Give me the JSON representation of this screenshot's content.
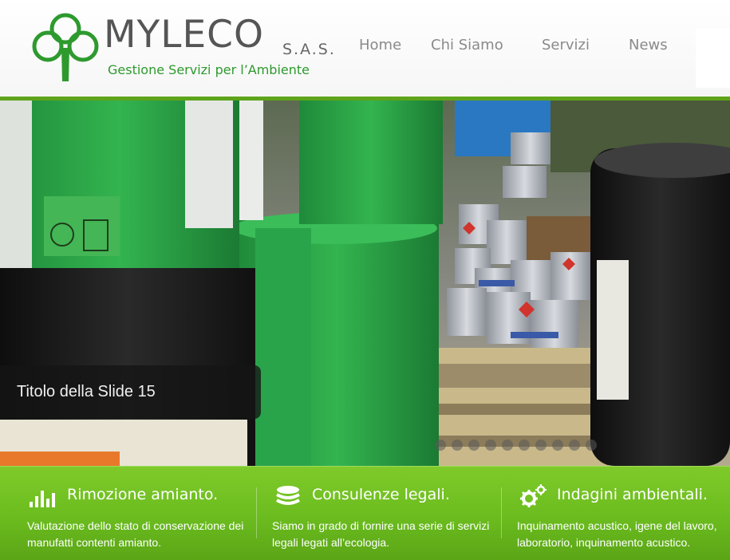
{
  "brand": {
    "name": "MYLECO",
    "suffix": "S.A.S.",
    "tagline": "Gestione Servizi per l’Ambiente",
    "logo_icon": "clover-tree-icon",
    "color": "#2e9a2e"
  },
  "nav": {
    "items": [
      {
        "label": "Home"
      },
      {
        "label": "Chi Siamo"
      },
      {
        "label": "Servizi"
      },
      {
        "label": "News"
      }
    ]
  },
  "slider": {
    "caption": "Titolo della Slide 15",
    "slide_count": 10,
    "active_index": 9
  },
  "features": [
    {
      "icon": "bar-chart-icon",
      "title": "Rimozione amianto.",
      "text": "Valutazione dello stato di conservazione dei manufatti contenti amianto."
    },
    {
      "icon": "stack-icon",
      "title": "Consulenze legali.",
      "text": "Siamo in grado di fornire una serie di servizi legali legati all’ecologia."
    },
    {
      "icon": "gears-icon",
      "title": "Indagini ambientali.",
      "text": "Inquinamento acustico, igene del lavoro, laboratorio, inquinamento acustico."
    }
  ],
  "colors": {
    "accent_green": "#6bbc1f",
    "nav_text": "#8a8a8a"
  }
}
